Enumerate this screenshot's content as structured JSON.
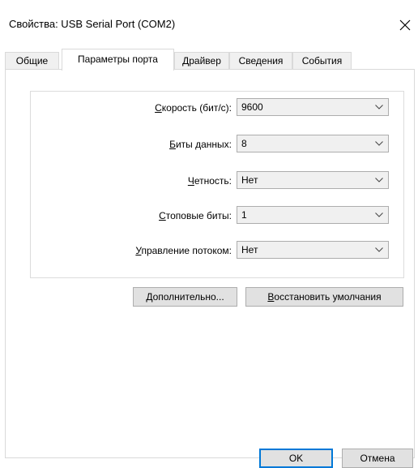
{
  "window": {
    "title": "Свойства: USB Serial Port (COM2)"
  },
  "tabs": [
    {
      "label": "Общие"
    },
    {
      "label": "Параметры порта"
    },
    {
      "label": "Драйвер"
    },
    {
      "label": "Сведения"
    },
    {
      "label": "События"
    }
  ],
  "settings": {
    "speed": {
      "label_u": "С",
      "label_rest": "корость (бит/с):",
      "value": "9600"
    },
    "data_bits": {
      "label_u": "Б",
      "label_rest": "иты данных:",
      "value": "8"
    },
    "parity": {
      "label_u": "Ч",
      "label_rest": "етность:",
      "value": "Нет"
    },
    "stop_bits": {
      "label_u": "С",
      "label_rest": "топовые биты:",
      "value": "1"
    },
    "flow": {
      "label_u": "У",
      "label_rest": "правление потоком:",
      "value": "Нет"
    }
  },
  "buttons": {
    "advanced_u": "Д",
    "advanced_rest": "ополнительно...",
    "restore_u": "В",
    "restore_rest": "осстановить умолчания",
    "ok": "OK",
    "cancel": "Отмена"
  }
}
